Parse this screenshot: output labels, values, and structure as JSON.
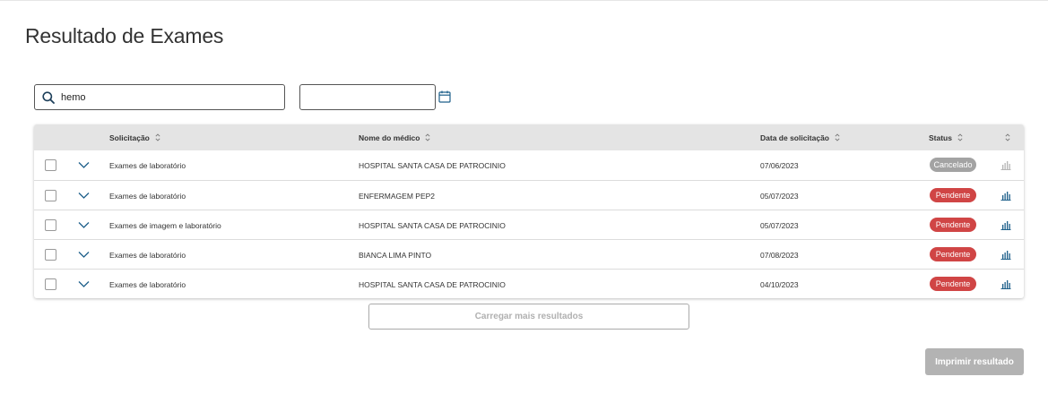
{
  "page": {
    "title": "Resultado de Exames"
  },
  "filters": {
    "search_value": "hemo",
    "search_placeholder": "",
    "date_value": "",
    "date_placeholder": ""
  },
  "table": {
    "headers": {
      "solicitacao": "Solicitação",
      "medico": "Nome do médico",
      "data": "Data de solicitação",
      "status": "Status"
    },
    "rows": [
      {
        "solicitacao": "Exames de laboratório",
        "medico": "HOSPITAL SANTA CASA DE PATROCINIO",
        "data": "07/06/2023",
        "status": "Cancelado",
        "status_color": "#a3a3a3",
        "chart_icon_color": "#b5b5b5"
      },
      {
        "solicitacao": "Exames de laboratório",
        "medico": "ENFERMAGEM PEP2",
        "data": "05/07/2023",
        "status": "Pendente",
        "status_color": "#d04545",
        "chart_icon_color": "#1d5f8a"
      },
      {
        "solicitacao": "Exames de imagem e laboratório",
        "medico": "HOSPITAL SANTA CASA DE PATROCINIO",
        "data": "05/07/2023",
        "status": "Pendente",
        "status_color": "#d04545",
        "chart_icon_color": "#1d5f8a"
      },
      {
        "solicitacao": "Exames de laboratório",
        "medico": "BIANCA LIMA PINTO",
        "data": "07/08/2023",
        "status": "Pendente",
        "status_color": "#d04545",
        "chart_icon_color": "#1d5f8a"
      },
      {
        "solicitacao": "Exames de laboratório",
        "medico": "HOSPITAL SANTA CASA DE PATROCINIO",
        "data": "04/10/2023",
        "status": "Pendente",
        "status_color": "#d04545",
        "chart_icon_color": "#1d5f8a"
      }
    ]
  },
  "actions": {
    "load_more": "Carregar mais resultados",
    "print": "Imprimir resultado"
  },
  "icons": {
    "search": "search-icon",
    "calendar": "calendar-icon",
    "sort": "sort-icon",
    "expand": "chevron-down-icon",
    "chart": "bar-chart-icon"
  },
  "colors": {
    "accent": "#1d5f8a",
    "pending": "#d04545",
    "cancelled": "#a3a3a3"
  }
}
